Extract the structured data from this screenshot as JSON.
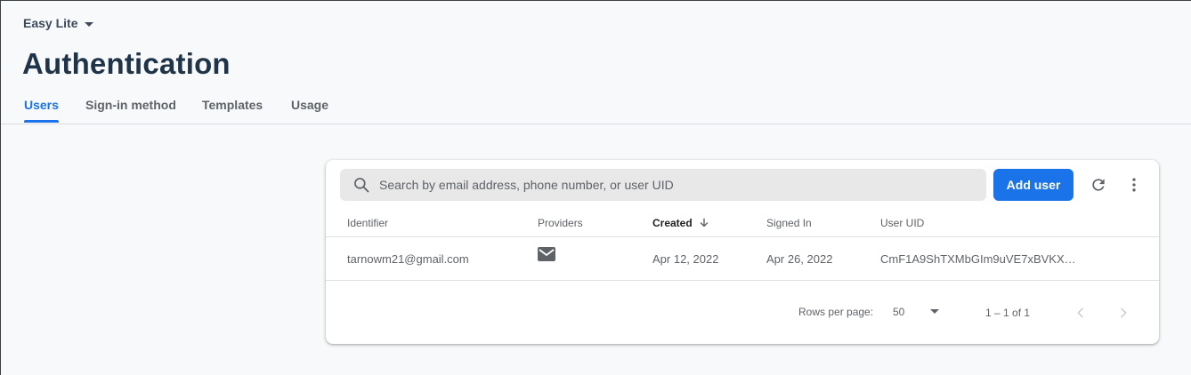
{
  "project": {
    "name": "Easy Lite",
    "dropdown_icon": "caret-down-icon"
  },
  "page": {
    "title": "Authentication"
  },
  "tabs": [
    {
      "label": "Users",
      "active": true
    },
    {
      "label": "Sign-in method",
      "active": false
    },
    {
      "label": "Templates",
      "active": false
    },
    {
      "label": "Usage",
      "active": false
    }
  ],
  "toolbar": {
    "search_placeholder": "Search by email address, phone number, or user UID",
    "add_user_label": "Add user",
    "refresh_icon": "refresh-icon",
    "more_icon": "more-vert-icon",
    "accent": "#1a73e8"
  },
  "table": {
    "columns": [
      "Identifier",
      "Providers",
      "Created",
      "Signed In",
      "User UID"
    ],
    "sorted_column": "Created",
    "rows": [
      {
        "identifier": "tarnowm21@gmail.com",
        "provider_icon": "email-icon",
        "created": "Apr 12, 2022",
        "signed_in": "Apr 26, 2022",
        "uid": "CmF1A9ShTXMbGIm9uVE7xBVKX…"
      }
    ]
  },
  "pagination": {
    "rows_per_page_label": "Rows per page:",
    "rows_per_page_value": "50",
    "range": "1 – 1 of 1"
  }
}
